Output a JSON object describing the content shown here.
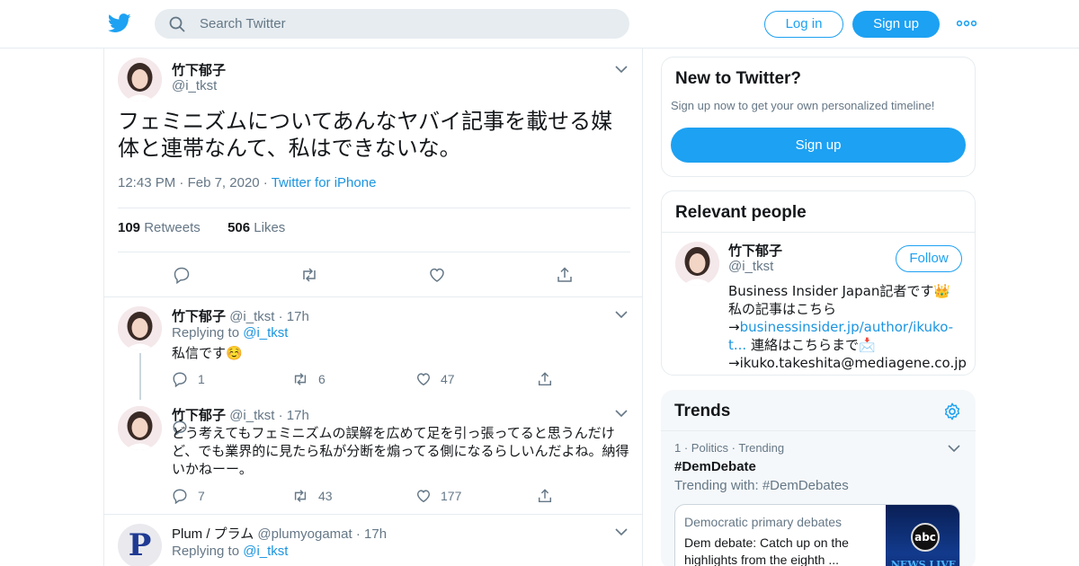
{
  "header": {
    "search_placeholder": "Search Twitter",
    "login_label": "Log in",
    "signup_label": "Sign up"
  },
  "tweet": {
    "name": "竹下郁子",
    "handle": "@i_tkst",
    "text": "フェミニズムについてあんなヤバイ記事を載せる媒体と連帯なんて、私はできないな。",
    "time": "12:43 PM",
    "date": "Feb 7, 2020",
    "source": "Twitter for iPhone",
    "retweets": "109",
    "retweets_label": "Retweets",
    "likes": "506",
    "likes_label": "Likes"
  },
  "replies": [
    {
      "name": "竹下郁子",
      "handle": "@i_tkst",
      "age": "17h",
      "replying_prefix": "Replying to",
      "replying_to": "@i_tkst",
      "text": "私信です☺️",
      "replies": "1",
      "retweets": "6",
      "likes": "47"
    },
    {
      "name": "竹下郁子",
      "handle": "@i_tkst",
      "age": "17h",
      "text": "どう考えてもフェミニズムの誤解を広めて足を引っ張ってると思うんだけど、でも業界的に見たら私が分断を煽ってる側になるらしいんだよね。納得いかねーー。",
      "replies": "7",
      "retweets": "43",
      "likes": "177"
    },
    {
      "name": "Plum / プラム",
      "handle": "@plumyogamat",
      "age": "17h",
      "replying_prefix": "Replying to",
      "replying_to": "@i_tkst",
      "avatar_letter": "P"
    }
  ],
  "new_to_twitter": {
    "title": "New to Twitter?",
    "subtitle": "Sign up now to get your own personalized timeline!",
    "button": "Sign up"
  },
  "relevant_people": {
    "title": "Relevant people",
    "name": "竹下郁子",
    "handle": "@i_tkst",
    "follow_label": "Follow",
    "bio_1": "Business Insider Japan記者です👑私の記事はこちら",
    "bio_arrow": "→",
    "bio_link": "businessinsider.jp/author/ikuko-t...",
    "bio_2": " 連絡はこちらまで📩",
    "bio_3": "→ikuko.takeshita@mediagene.co.jp"
  },
  "trends": {
    "title": "Trends",
    "rank": "1",
    "category": "Politics",
    "status": "Trending",
    "name": "#DemDebate",
    "trending_with": "Trending with: #DemDebates",
    "card_title": "Democratic primary debates",
    "card_text": "Dem debate: Catch up on the highlights from the eighth ...",
    "thumb_text": "abc",
    "thumb_sub": "NEWS LIVE"
  },
  "colors": {
    "brand": "#1da1f2",
    "link": "#1b95e0",
    "secondary_text": "#657786",
    "border": "#e6ecf0"
  }
}
